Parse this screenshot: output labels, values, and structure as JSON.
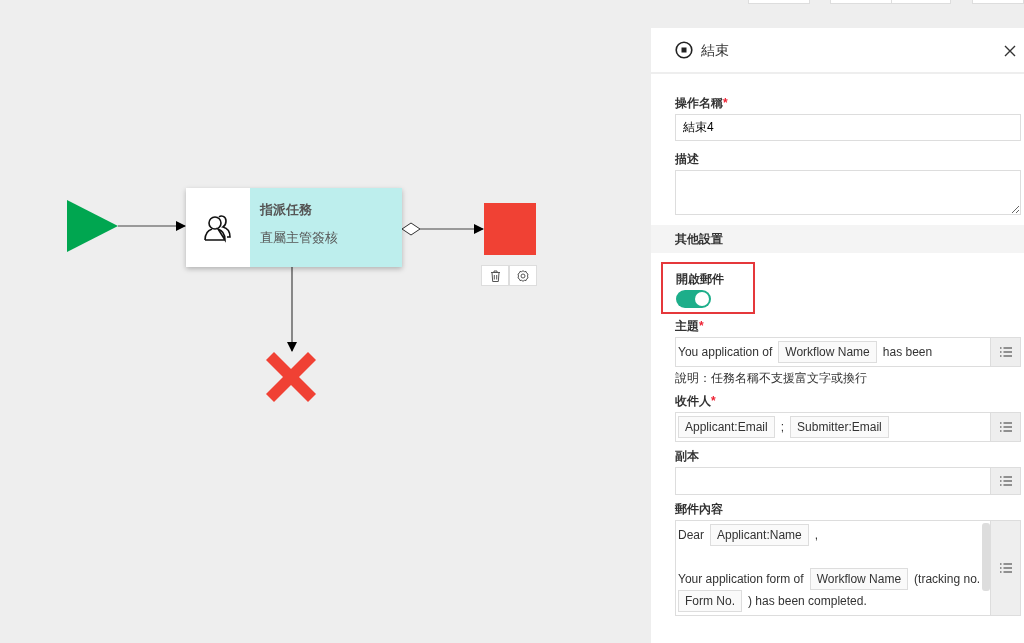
{
  "diagram": {
    "start": {
      "color": "#00a650"
    },
    "task": {
      "title": "指派任務",
      "subtitle": "直屬主管簽核"
    },
    "end": {
      "color": "#f04134",
      "selected": true
    },
    "cancel": {
      "color": "#f04134"
    }
  },
  "panel": {
    "title": "結束",
    "fields": [
      {
        "kind": "text",
        "label": "操作名稱",
        "required_mark": "*",
        "value": "結束4"
      },
      {
        "kind": "textarea",
        "label": "描述"
      }
    ],
    "section": "其他設置",
    "mail_toggle": {
      "label": "開啟郵件",
      "on": true,
      "highlighted": true
    },
    "mail_fields": [
      {
        "kind": "inline",
        "label": "主題",
        "required_mark": "*",
        "lines": [
          {
            "parts": [
              {
                "kind": "text",
                "text": "You application of"
              },
              {
                "kind": "token",
                "text": "Workflow Name"
              },
              {
                "kind": "text",
                "text": "has been"
              }
            ]
          }
        ],
        "hint": "說明：任務名稱不支援富文字或換行"
      },
      {
        "kind": "inline",
        "label": "收件人",
        "required_mark": "*",
        "lines": [
          {
            "parts": [
              {
                "kind": "token",
                "text": "Applicant:Email"
              },
              {
                "kind": "text",
                "text": ";"
              },
              {
                "kind": "token",
                "text": "Submitter:Email"
              }
            ]
          }
        ]
      },
      {
        "kind": "inline",
        "label": "副本"
      },
      {
        "kind": "editor",
        "label": "郵件內容",
        "lines": [
          {
            "parts": [
              {
                "kind": "text",
                "text": "Dear"
              },
              {
                "kind": "token",
                "text": "Applicant:Name"
              },
              {
                "kind": "text",
                "text": ","
              }
            ]
          },
          {
            "gap_before": true,
            "parts": [
              {
                "kind": "text",
                "text": "Your application form of"
              },
              {
                "kind": "token",
                "text": "Workflow Name"
              },
              {
                "kind": "text",
                "text": "(tracking no."
              }
            ]
          },
          {
            "parts": [
              {
                "kind": "token",
                "text": "Form No."
              },
              {
                "kind": "text",
                "text": ") has been completed."
              }
            ]
          }
        ]
      }
    ]
  }
}
